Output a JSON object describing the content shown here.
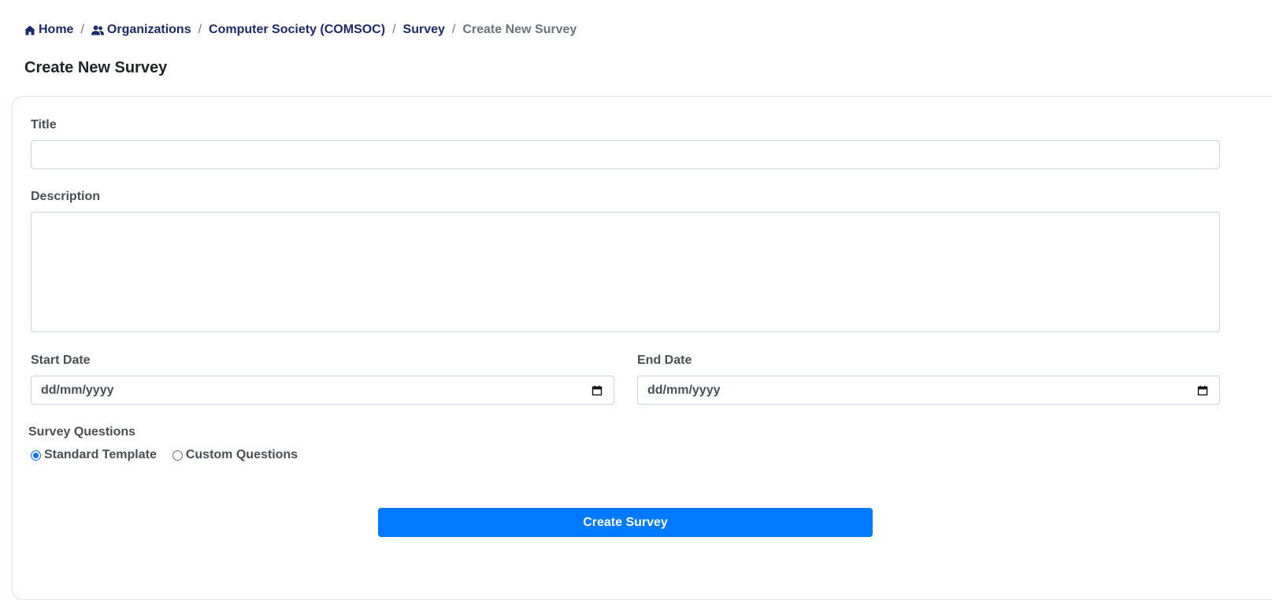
{
  "breadcrumb": {
    "home": "Home",
    "organizations": "Organizations",
    "organization": "Computer Society (COMSOC)",
    "survey": "Survey",
    "current": "Create New Survey",
    "separator": "/"
  },
  "page": {
    "title": "Create New Survey"
  },
  "form": {
    "title_label": "Title",
    "title_value": "",
    "description_label": "Description",
    "description_value": "",
    "start_date_label": "Start Date",
    "start_date_placeholder": "dd/mm/yyyy",
    "end_date_label": "End Date",
    "end_date_placeholder": "dd/mm/yyyy",
    "questions_label": "Survey Questions",
    "options": {
      "standard": "Standard Template",
      "custom": "Custom Questions"
    },
    "selected_option": "Standard Template",
    "submit_label": "Create Survey"
  },
  "icons": {
    "home": "home-icon",
    "organizations": "users-icon",
    "date": "calendar-icon"
  },
  "colors": {
    "link": "#1c2a6b",
    "muted": "#6c757d",
    "primary": "#007bff",
    "radio_selected": "#0d6efd"
  }
}
